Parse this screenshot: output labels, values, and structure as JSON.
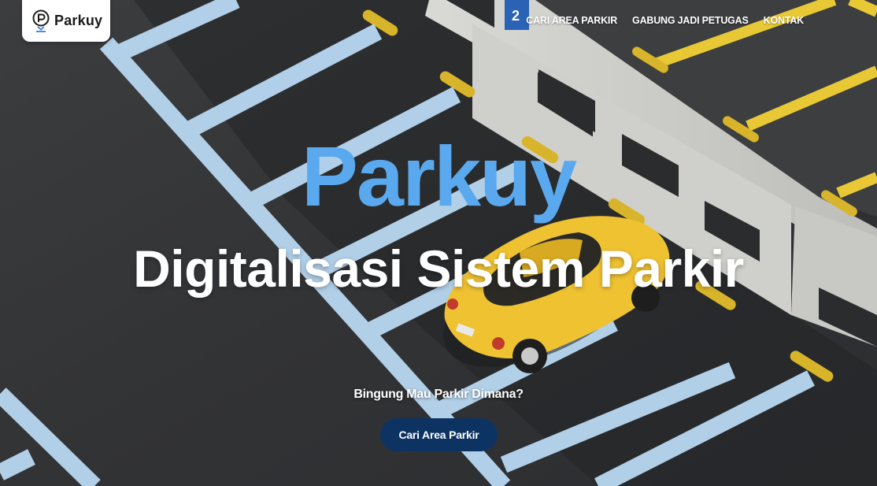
{
  "logo": {
    "text": "Parkuy",
    "icon": "parking-pin-icon"
  },
  "nav": {
    "items": [
      {
        "label": "CARI AREA PARKIR"
      },
      {
        "label": "GABUNG JADI PETUGAS"
      },
      {
        "label": "KONTAK"
      }
    ]
  },
  "hero": {
    "brand": "Parkuy",
    "headline": "Digitalisasi Sistem Parkir",
    "question": "Bingung Mau Parkir Dimana?",
    "cta_label": "Cari Area Parkir"
  },
  "colors": {
    "brand_blue": "#5aa9ee",
    "cta_navy": "#0d3363",
    "parking_line_yellow": "#e8c935",
    "parking_line_blue": "#b9d8f2",
    "car_yellow": "#efc232"
  }
}
